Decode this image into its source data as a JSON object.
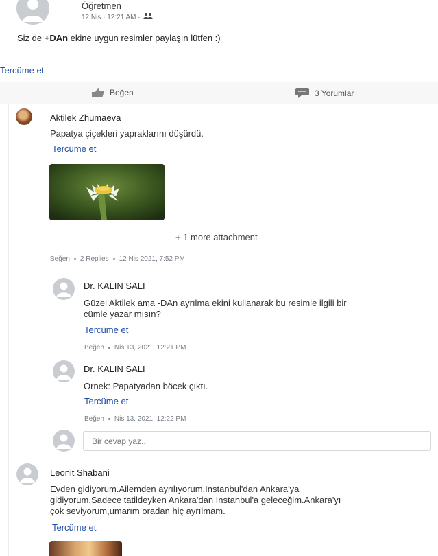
{
  "post": {
    "role": "Öğretmen",
    "time": "12 Nis · 12:21 AM ·",
    "body_prefix": "Siz de ",
    "body_bold": "+DAn",
    "body_suffix": " ekine uygun resimler paylaşın lütfen :)",
    "translate": "Tercüme et"
  },
  "actions": {
    "like_label": "Beğen",
    "comments_label": "3 Yorumlar"
  },
  "comment1": {
    "author": "Aktilek Zhumaeva",
    "text": "Papatya çiçekleri yapraklarını düşürdü.",
    "translate": "Tercüme et",
    "more_attachments": "+ 1 more attachment",
    "like": "Beğen",
    "replies": "2 Replies",
    "time": "12 Nis 2021, 7:52 PM"
  },
  "reply1": {
    "author": "Dr. KALIN SALI",
    "text_line1": "Güzel Aktilek ama -DAn ayrılma ekini kullanarak bu resimle ilgili bir",
    "text_line2": "cümle yazar mısın?",
    "translate": "Tercüme et",
    "like": "Beğen",
    "time": "Nis 13, 2021, 12:21 PM"
  },
  "reply2": {
    "author": "Dr. KALIN SALI",
    "text": "Örnek: Papatyadan böcek çıktı.",
    "translate": "Tercüme et",
    "like": "Beğen",
    "time": "Nis 13, 2021, 12:22 PM"
  },
  "reply_input": {
    "placeholder": "Bir cevap yaz..."
  },
  "comment2": {
    "author": "Leonit Shabani",
    "text_line1": "Evden gidiyorum.Ailemden ayrılıyorum.Instanbul'dan Ankara'ya",
    "text_line2": "gidiyorum.Sadece tatildeyken Ankara'dan Instanbul'a geleceğim.Ankara'yı",
    "text_line3": "çok seviyorum,umarım oradan hiç ayrılmam.",
    "translate": "Tercüme et"
  },
  "colors": {
    "link": "#1f4ea8",
    "avatar_gray": "#c9cdd2",
    "action_bar_bg": "#f7f7f8"
  }
}
